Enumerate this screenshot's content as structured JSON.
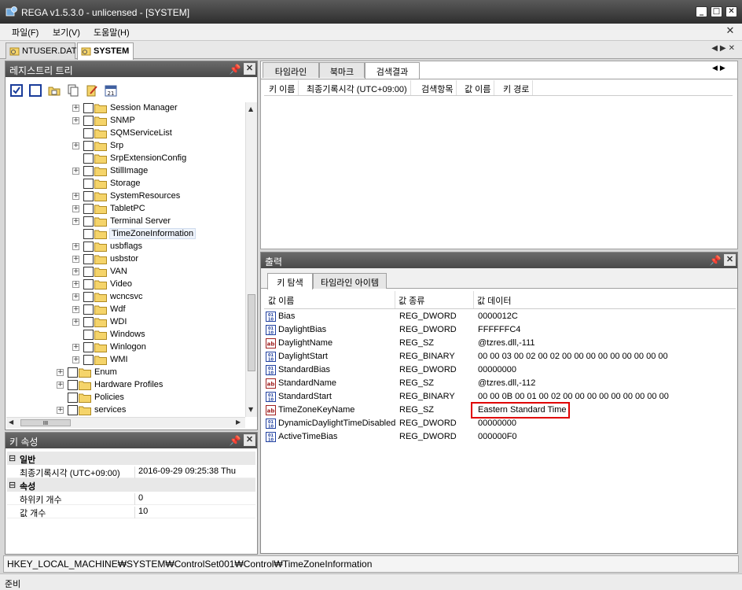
{
  "window": {
    "title": "REGA v1.5.3.0 - unlicensed - [SYSTEM]"
  },
  "menu": {
    "items": [
      "파일(F)",
      "보기(V)",
      "도움말(H)"
    ]
  },
  "doc_tabs": [
    {
      "label": "NTUSER.DAT",
      "active": false
    },
    {
      "label": "SYSTEM",
      "active": true
    }
  ],
  "registry_tree": {
    "title": "레지스트리 트리",
    "toolbar": [
      "check-all-icon",
      "uncheck-all-icon",
      "folder-open-icon",
      "copy-icon",
      "edit-icon",
      "calendar-icon"
    ],
    "calendar_day": "21",
    "nodes": [
      {
        "label": "Session Manager",
        "level": 2,
        "expandable": true
      },
      {
        "label": "SNMP",
        "level": 2,
        "expandable": true
      },
      {
        "label": "SQMServiceList",
        "level": 2,
        "expandable": false
      },
      {
        "label": "Srp",
        "level": 2,
        "expandable": true
      },
      {
        "label": "SrpExtensionConfig",
        "level": 2,
        "expandable": false
      },
      {
        "label": "StillImage",
        "level": 2,
        "expandable": true
      },
      {
        "label": "Storage",
        "level": 2,
        "expandable": false
      },
      {
        "label": "SystemResources",
        "level": 2,
        "expandable": true
      },
      {
        "label": "TabletPC",
        "level": 2,
        "expandable": true
      },
      {
        "label": "Terminal Server",
        "level": 2,
        "expandable": true
      },
      {
        "label": "TimeZoneInformation",
        "level": 2,
        "expandable": false,
        "selected": true
      },
      {
        "label": "usbflags",
        "level": 2,
        "expandable": true
      },
      {
        "label": "usbstor",
        "level": 2,
        "expandable": true
      },
      {
        "label": "VAN",
        "level": 2,
        "expandable": true
      },
      {
        "label": "Video",
        "level": 2,
        "expandable": true
      },
      {
        "label": "wcncsvc",
        "level": 2,
        "expandable": true
      },
      {
        "label": "Wdf",
        "level": 2,
        "expandable": true
      },
      {
        "label": "WDI",
        "level": 2,
        "expandable": true
      },
      {
        "label": "Windows",
        "level": 2,
        "expandable": false
      },
      {
        "label": "Winlogon",
        "level": 2,
        "expandable": true
      },
      {
        "label": "WMI",
        "level": 2,
        "expandable": true
      },
      {
        "label": "Enum",
        "level": 1,
        "expandable": true
      },
      {
        "label": "Hardware Profiles",
        "level": 1,
        "expandable": true
      },
      {
        "label": "Policies",
        "level": 1,
        "expandable": false
      },
      {
        "label": "services",
        "level": 1,
        "expandable": true
      }
    ],
    "hscroll_grip": "III"
  },
  "key_properties": {
    "title": "키 속성",
    "sections": [
      {
        "name": "일반",
        "rows": [
          {
            "name": "최종기록시각 (UTC+09:00)",
            "value": "2016-09-29  09:25:38  Thu"
          }
        ]
      },
      {
        "name": "속성",
        "rows": [
          {
            "name": "하위키 개수",
            "value": "0"
          },
          {
            "name": "값 개수",
            "value": "10"
          }
        ]
      }
    ]
  },
  "top_tabs": {
    "tabs": [
      "타임라인",
      "북마크",
      "검색결과"
    ],
    "active": "검색결과",
    "columns": [
      "키 이름",
      "최종기록시각 (UTC+09:00)",
      "검색항목",
      "값 이름",
      "키 경로"
    ]
  },
  "output": {
    "title": "출력",
    "tabs": [
      "키 탐색",
      "타임라인 아이템"
    ],
    "active": "키 탐색",
    "columns": [
      "값 이름",
      "값 종류",
      "값 데이터"
    ],
    "rows": [
      {
        "name": "Bias",
        "type": "REG_DWORD",
        "data": "0000012C",
        "icon": "binary-value-icon"
      },
      {
        "name": "DaylightBias",
        "type": "REG_DWORD",
        "data": "FFFFFFC4",
        "icon": "binary-value-icon"
      },
      {
        "name": "DaylightName",
        "type": "REG_SZ",
        "data": "@tzres.dll,-111",
        "icon": "string-value-icon"
      },
      {
        "name": "DaylightStart",
        "type": "REG_BINARY",
        "data": "00 00 03 00 02 00 02 00 00 00 00 00 00 00 00 00",
        "icon": "binary-value-icon"
      },
      {
        "name": "StandardBias",
        "type": "REG_DWORD",
        "data": "00000000",
        "icon": "binary-value-icon"
      },
      {
        "name": "StandardName",
        "type": "REG_SZ",
        "data": "@tzres.dll,-112",
        "icon": "string-value-icon"
      },
      {
        "name": "StandardStart",
        "type": "REG_BINARY",
        "data": "00 00 0B 00 01 00 02 00 00 00 00 00 00 00 00 00",
        "icon": "binary-value-icon"
      },
      {
        "name": "TimeZoneKeyName",
        "type": "REG_SZ",
        "data": "Eastern Standard Time",
        "icon": "string-value-icon",
        "highlighted": true
      },
      {
        "name": "DynamicDaylightTimeDisabled",
        "type": "REG_DWORD",
        "data": "00000000",
        "icon": "binary-value-icon"
      },
      {
        "name": "ActiveTimeBias",
        "type": "REG_DWORD",
        "data": "000000F0",
        "icon": "binary-value-icon"
      }
    ]
  },
  "path_bar": "HKEY_LOCAL_MACHINE₩SYSTEM₩ControlSet001₩Control₩TimeZoneInformation",
  "status": "준비",
  "colors": {
    "highlight_border": "#e00000",
    "header_dark": "#4a4a4a",
    "folder": "#f5d46a"
  }
}
